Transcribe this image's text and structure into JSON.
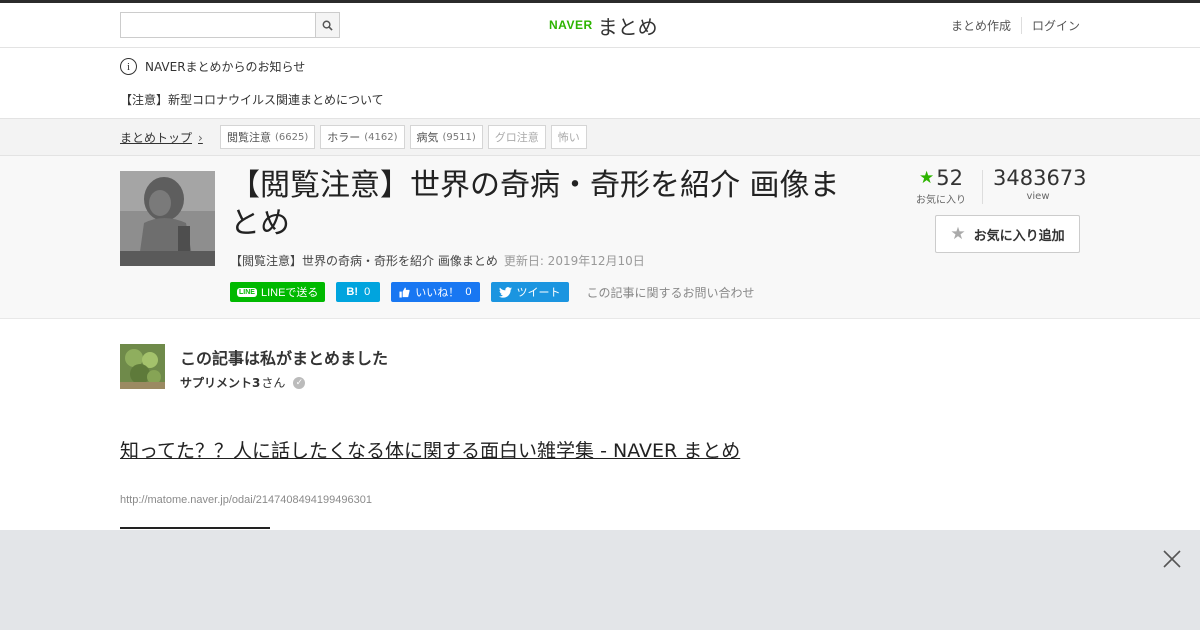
{
  "header": {
    "search_placeholder": "",
    "logo_naver": "NAVER",
    "logo_matome": "まとめ",
    "nav": [
      "まとめ作成",
      "ログイン"
    ]
  },
  "notice": {
    "title": "NAVERまとめからのお知らせ",
    "item": "【注意】新型コロナウイルス関連まとめについて"
  },
  "breadcrumb": {
    "top": "まとめトップ",
    "tags": [
      {
        "label": "閲覧注意",
        "count": "(6625)"
      },
      {
        "label": "ホラー",
        "count": "(4162)"
      },
      {
        "label": "病気",
        "count": "(9511)"
      },
      {
        "label": "グロ注意",
        "count": ""
      },
      {
        "label": "怖い",
        "count": ""
      }
    ]
  },
  "article": {
    "title": "【閲覧注意】世界の奇病・奇形を紹介 画像まとめ",
    "subtitle": "【閲覧注意】世界の奇病・奇形を紹介 画像まとめ",
    "updated": "更新日: 2019年12月10日",
    "favorites": "52",
    "favorites_label": "お気に入り",
    "views": "3483673",
    "views_label": "view",
    "fav_button": "お気に入り追加"
  },
  "social": {
    "line_badge": "LINE",
    "line": "LINEで送る",
    "hatena": "B!",
    "hatena_count": "0",
    "fb": "いいね！",
    "fb_count": "0",
    "tweet": "ツイート",
    "contact": "この記事に関するお問い合わせ"
  },
  "author": {
    "heading": "この記事は私がまとめました",
    "name": "サプリメント3",
    "suffix": "さん"
  },
  "content": {
    "link_title": "知ってた？？人に話したくなる体に関する面白い雑学集 - NAVER まとめ",
    "link_url": "http://matome.naver.jp/odai/2147408494199496301"
  },
  "colors": {
    "accent": "#2db400",
    "line": "#00b900",
    "hatena": "#00a4de",
    "facebook": "#1877f2",
    "twitter": "#1b95e0"
  }
}
